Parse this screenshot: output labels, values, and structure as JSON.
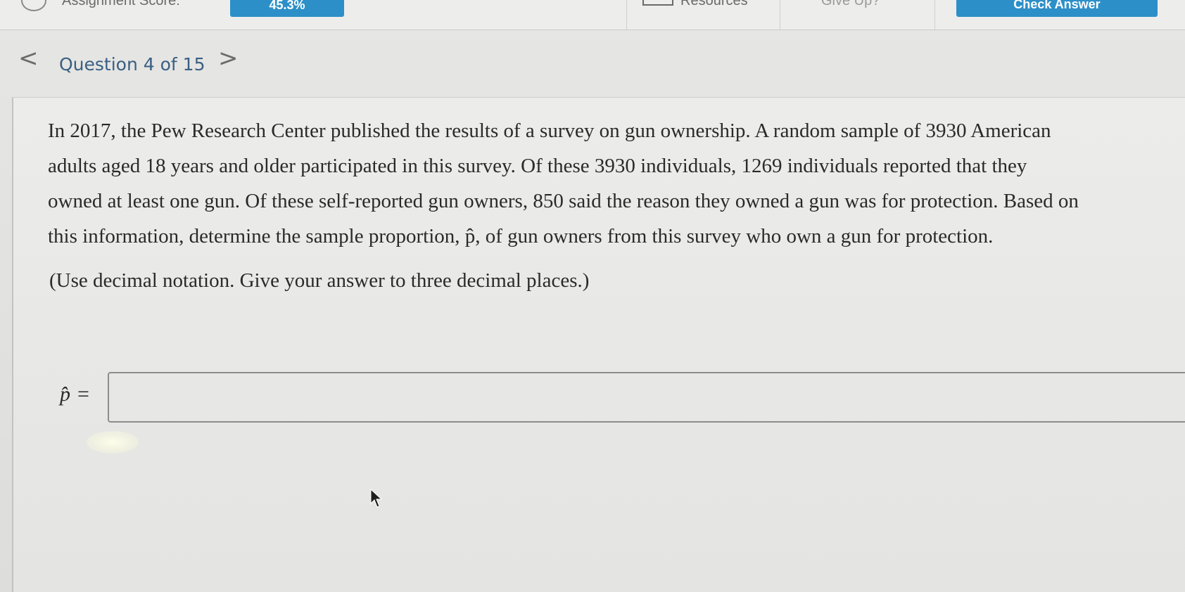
{
  "topbar": {
    "assignment_score_label": "Assignment Score:",
    "score_value": "45.3%",
    "resources_label": "Resources",
    "give_up_label": "Give Up?",
    "check_answer_label": "Check Answer"
  },
  "nav": {
    "question_label": "Question 4 of 15",
    "prev_glyph": "<",
    "next_glyph": ">"
  },
  "question": {
    "lines": [
      "In 2017, the Pew Research Center published the results of a survey on gun ownership. A random sample of 3930 American",
      "adults aged 18 years and older participated in this survey. Of these 3930 individuals, 1269 individuals reported that they",
      "owned at least one gun. Of these self-reported gun owners, 850 said the reason they owned a gun was for protection. Based on",
      "this information, determine the sample proportion, p̂, of gun owners from this survey who own a gun for protection."
    ],
    "instruction": "(Use decimal notation. Give your answer to three decimal places.)"
  },
  "answer": {
    "label": "p̂",
    "equals": "=",
    "value": ""
  },
  "colors": {
    "accent": "#2d8fc8",
    "nav_text": "#3a5f82"
  }
}
